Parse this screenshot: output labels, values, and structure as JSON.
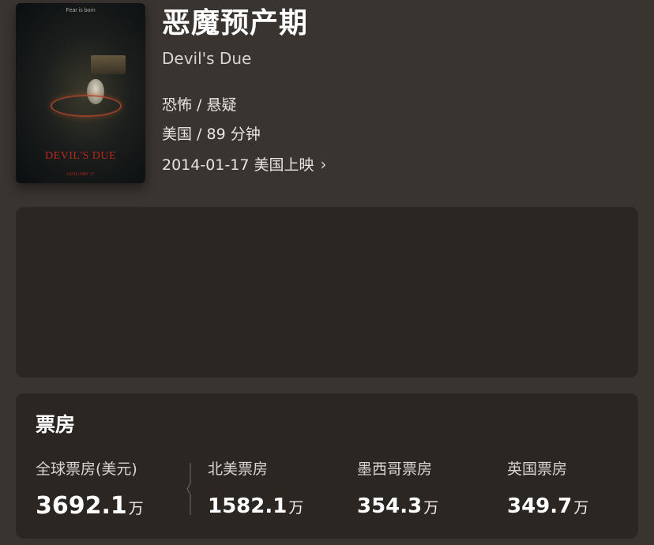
{
  "poster": {
    "tagline": "Fear is born",
    "title": "DEVIL'S DUE",
    "date": "JANUARY 17"
  },
  "movie": {
    "title_cn": "恶魔预产期",
    "title_en": "Devil's Due",
    "genres": "恐怖 / 悬疑",
    "country_duration": "美国 / 89 分钟",
    "release": "2014-01-17 美国上映",
    "release_chevron": "›"
  },
  "box_office": {
    "title": "票房",
    "stats": [
      {
        "label": "全球票房(美元)",
        "value": "3692.1",
        "unit": "万"
      },
      {
        "label": "北美票房",
        "value": "1582.1",
        "unit": "万"
      },
      {
        "label": "墨西哥票房",
        "value": "354.3",
        "unit": "万"
      },
      {
        "label": "英国票房",
        "value": "349.7",
        "unit": "万"
      }
    ]
  },
  "colors": {
    "background": "#3a3430",
    "panel": "#2b2622",
    "accent_red": "#b8281e"
  }
}
